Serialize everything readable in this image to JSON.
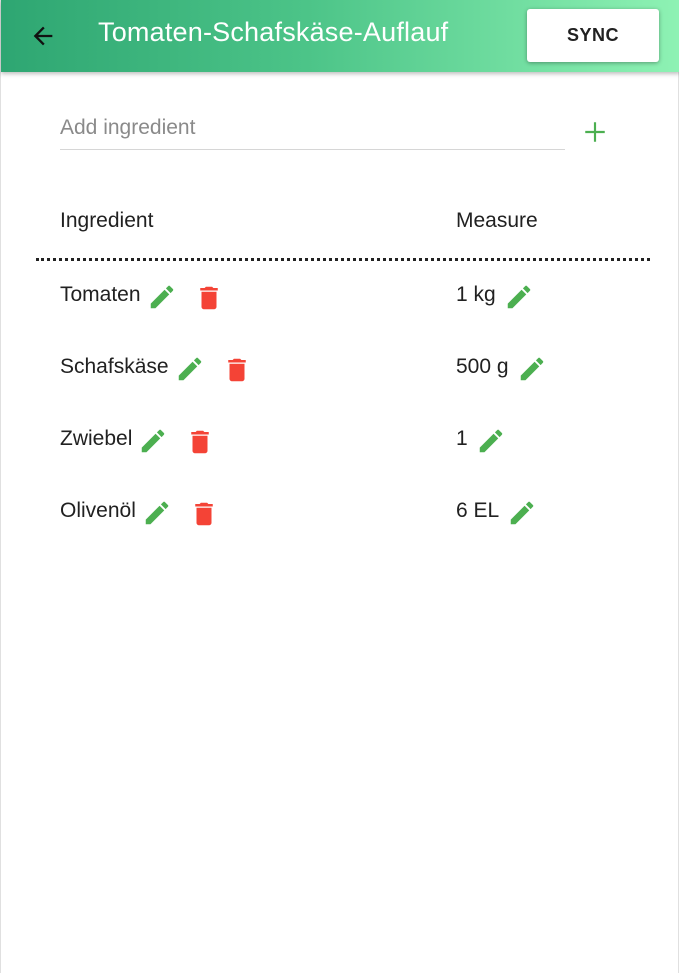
{
  "appbar": {
    "title": "Tomaten-Schafskäse-Auflauf",
    "sync_label": "SYNC",
    "back_icon": "arrow-left-icon"
  },
  "add_ingredient": {
    "placeholder": "Add ingredient",
    "value": "",
    "add_icon": "plus-icon"
  },
  "table": {
    "headers": {
      "ingredient": "Ingredient",
      "measure": "Measure"
    },
    "rows": [
      {
        "name": "Tomaten",
        "measure": "1 kg"
      },
      {
        "name": "Schafskäse",
        "measure": "500 g"
      },
      {
        "name": "Zwiebel",
        "measure": "1"
      },
      {
        "name": "Olivenöl",
        "measure": "6 EL"
      }
    ]
  },
  "colors": {
    "appbar_start": "#2ea672",
    "appbar_end": "#8ef2b4",
    "edit_icon": "#4caf50",
    "delete_icon": "#f44336"
  }
}
